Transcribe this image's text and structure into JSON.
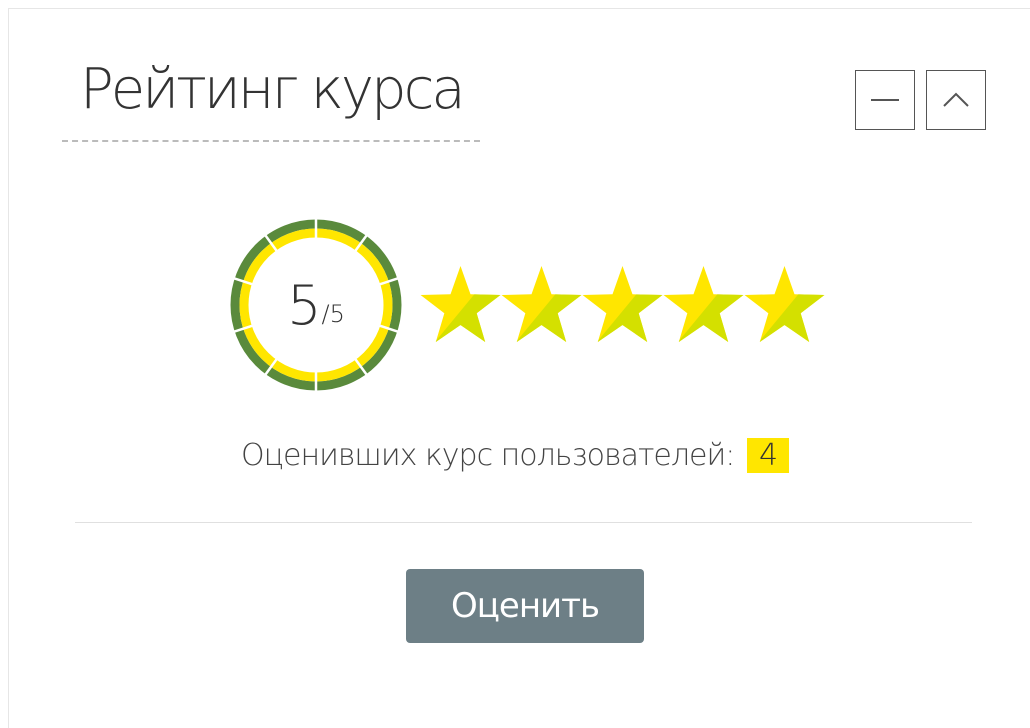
{
  "widget": {
    "title": "Рейтинг курса",
    "collapse_icon": "minus-icon",
    "scroll_up_icon": "chevron-up-icon"
  },
  "rating": {
    "score": "5",
    "max": "/5",
    "score_fraction": 1.0,
    "stars_filled": 5,
    "stars_total": 5,
    "colors": {
      "ring_outer": "#5a8a3c",
      "ring_inner": "#ffe600",
      "star_light": "#ffe600",
      "star_dark": "#d4e000"
    }
  },
  "raters": {
    "label": "Оценивших курс пользователей:",
    "count": "4",
    "highlight_color": "#ffe600"
  },
  "actions": {
    "rate_label": "Оценить",
    "rate_button_color": "#6d7f86"
  }
}
